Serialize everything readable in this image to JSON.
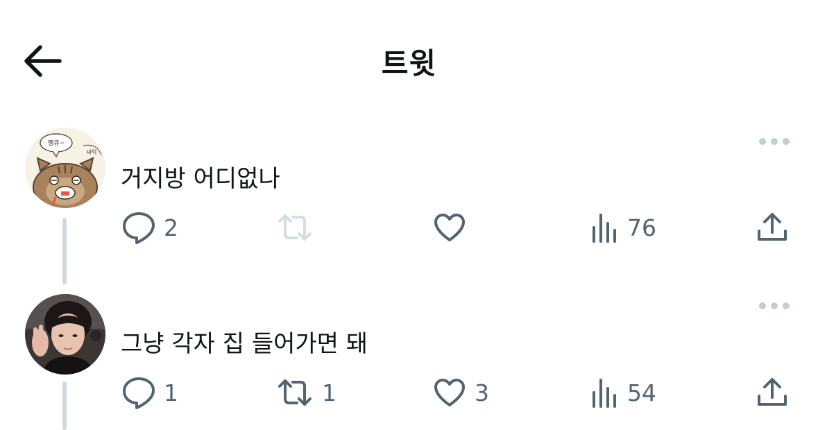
{
  "header": {
    "title": "트윗",
    "back_icon": "arrow-left-icon"
  },
  "tweets": [
    {
      "text": "거지방 어디없나",
      "avatar_bubbles": [
        "땡큐~",
        "씨익"
      ],
      "actions": {
        "reply": "2",
        "retweet": "",
        "like": "",
        "views": "76"
      },
      "retweet_enabled": false
    },
    {
      "text": "그냥 각자 집 들어가면 돼",
      "actions": {
        "reply": "1",
        "retweet": "1",
        "like": "3",
        "views": "54"
      },
      "retweet_enabled": true
    }
  ],
  "colors": {
    "icon": "#536471",
    "text": "#0f1419",
    "thread_line": "#cfd9de",
    "disabled_icon": "#d4dde3",
    "more_dots": "#c2cdd4"
  }
}
